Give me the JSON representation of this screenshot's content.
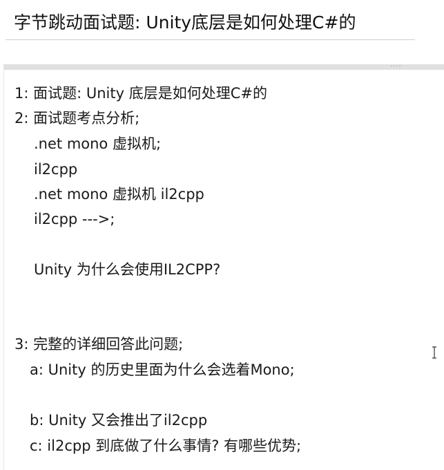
{
  "title": "字节跳动面试题: Unity底层是如何处理C#的",
  "note": {
    "handle": "····",
    "lines": [
      "1: 面试题: Unity 底层是如何处理C#的",
      "2: 面试题考点分析;",
      ".net mono 虚拟机;",
      "il2cpp",
      ".net mono 虚拟机 il2cpp",
      "il2cpp --->;",
      "Unity 为什么会使用IL2CPP?",
      "3: 完整的详细回答此问题;",
      "a: Unity 的历史里面为什么会选着Mono;",
      "b: Unity 又会推出了il2cpp",
      "c: il2cpp 到底做了什么事情? 有哪些优势;"
    ]
  },
  "icons": {
    "cursor": "text-cursor-icon"
  }
}
